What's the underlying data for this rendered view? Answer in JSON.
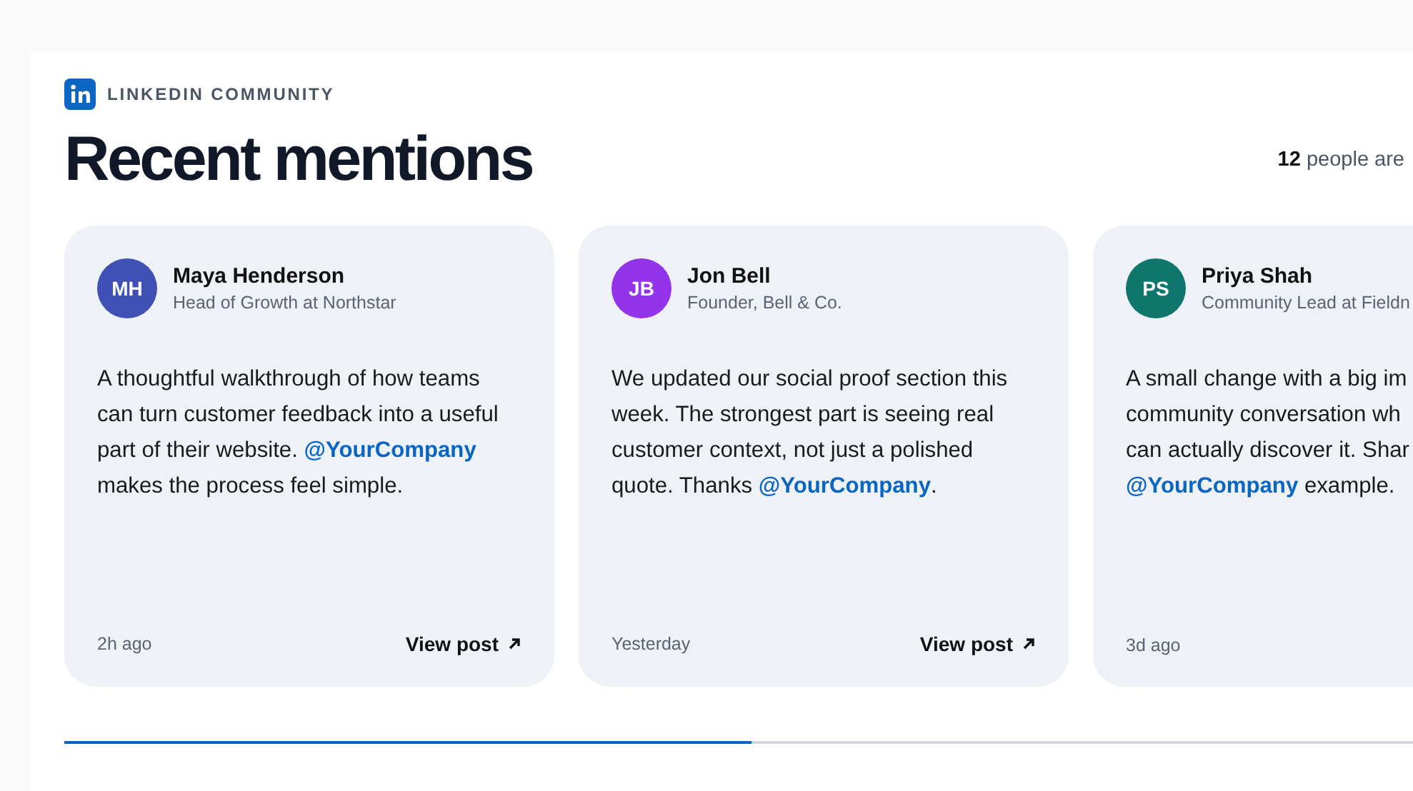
{
  "header": {
    "eyebrow": "LINKEDIN COMMUNITY",
    "title": "Recent mentions",
    "count": "12",
    "count_label": "people are"
  },
  "posts": [
    {
      "initials": "MH",
      "color": "#3f51b5",
      "name": "Maya Henderson",
      "role": "Head of Growth at Northstar",
      "lines": [
        "A thoughtful walkthrough of how teams",
        "can turn customer feedback into a useful",
        "part of their website. **@YourCompany**",
        "makes the process feel simple."
      ],
      "time": "2h ago",
      "link": "View post"
    },
    {
      "initials": "JB",
      "color": "#9333ea",
      "name": "Jon Bell",
      "role": "Founder, Bell & Co.",
      "lines": [
        "We updated our social proof section this",
        "week. The strongest part is seeing real",
        "customer context, not just a polished",
        "quote. Thanks **@YourCompany**."
      ],
      "time": "Yesterday",
      "link": "View post"
    },
    {
      "initials": "PS",
      "color": "#0f766e",
      "name": "Priya Shah",
      "role": "Community Lead at Fieldn",
      "lines": [
        "A small change with a big im",
        "community conversation wh",
        "can actually discover it. Shar",
        "**@YourCompany** example."
      ],
      "time": "3d ago"
    }
  ],
  "progress": {
    "level": 0.51
  }
}
